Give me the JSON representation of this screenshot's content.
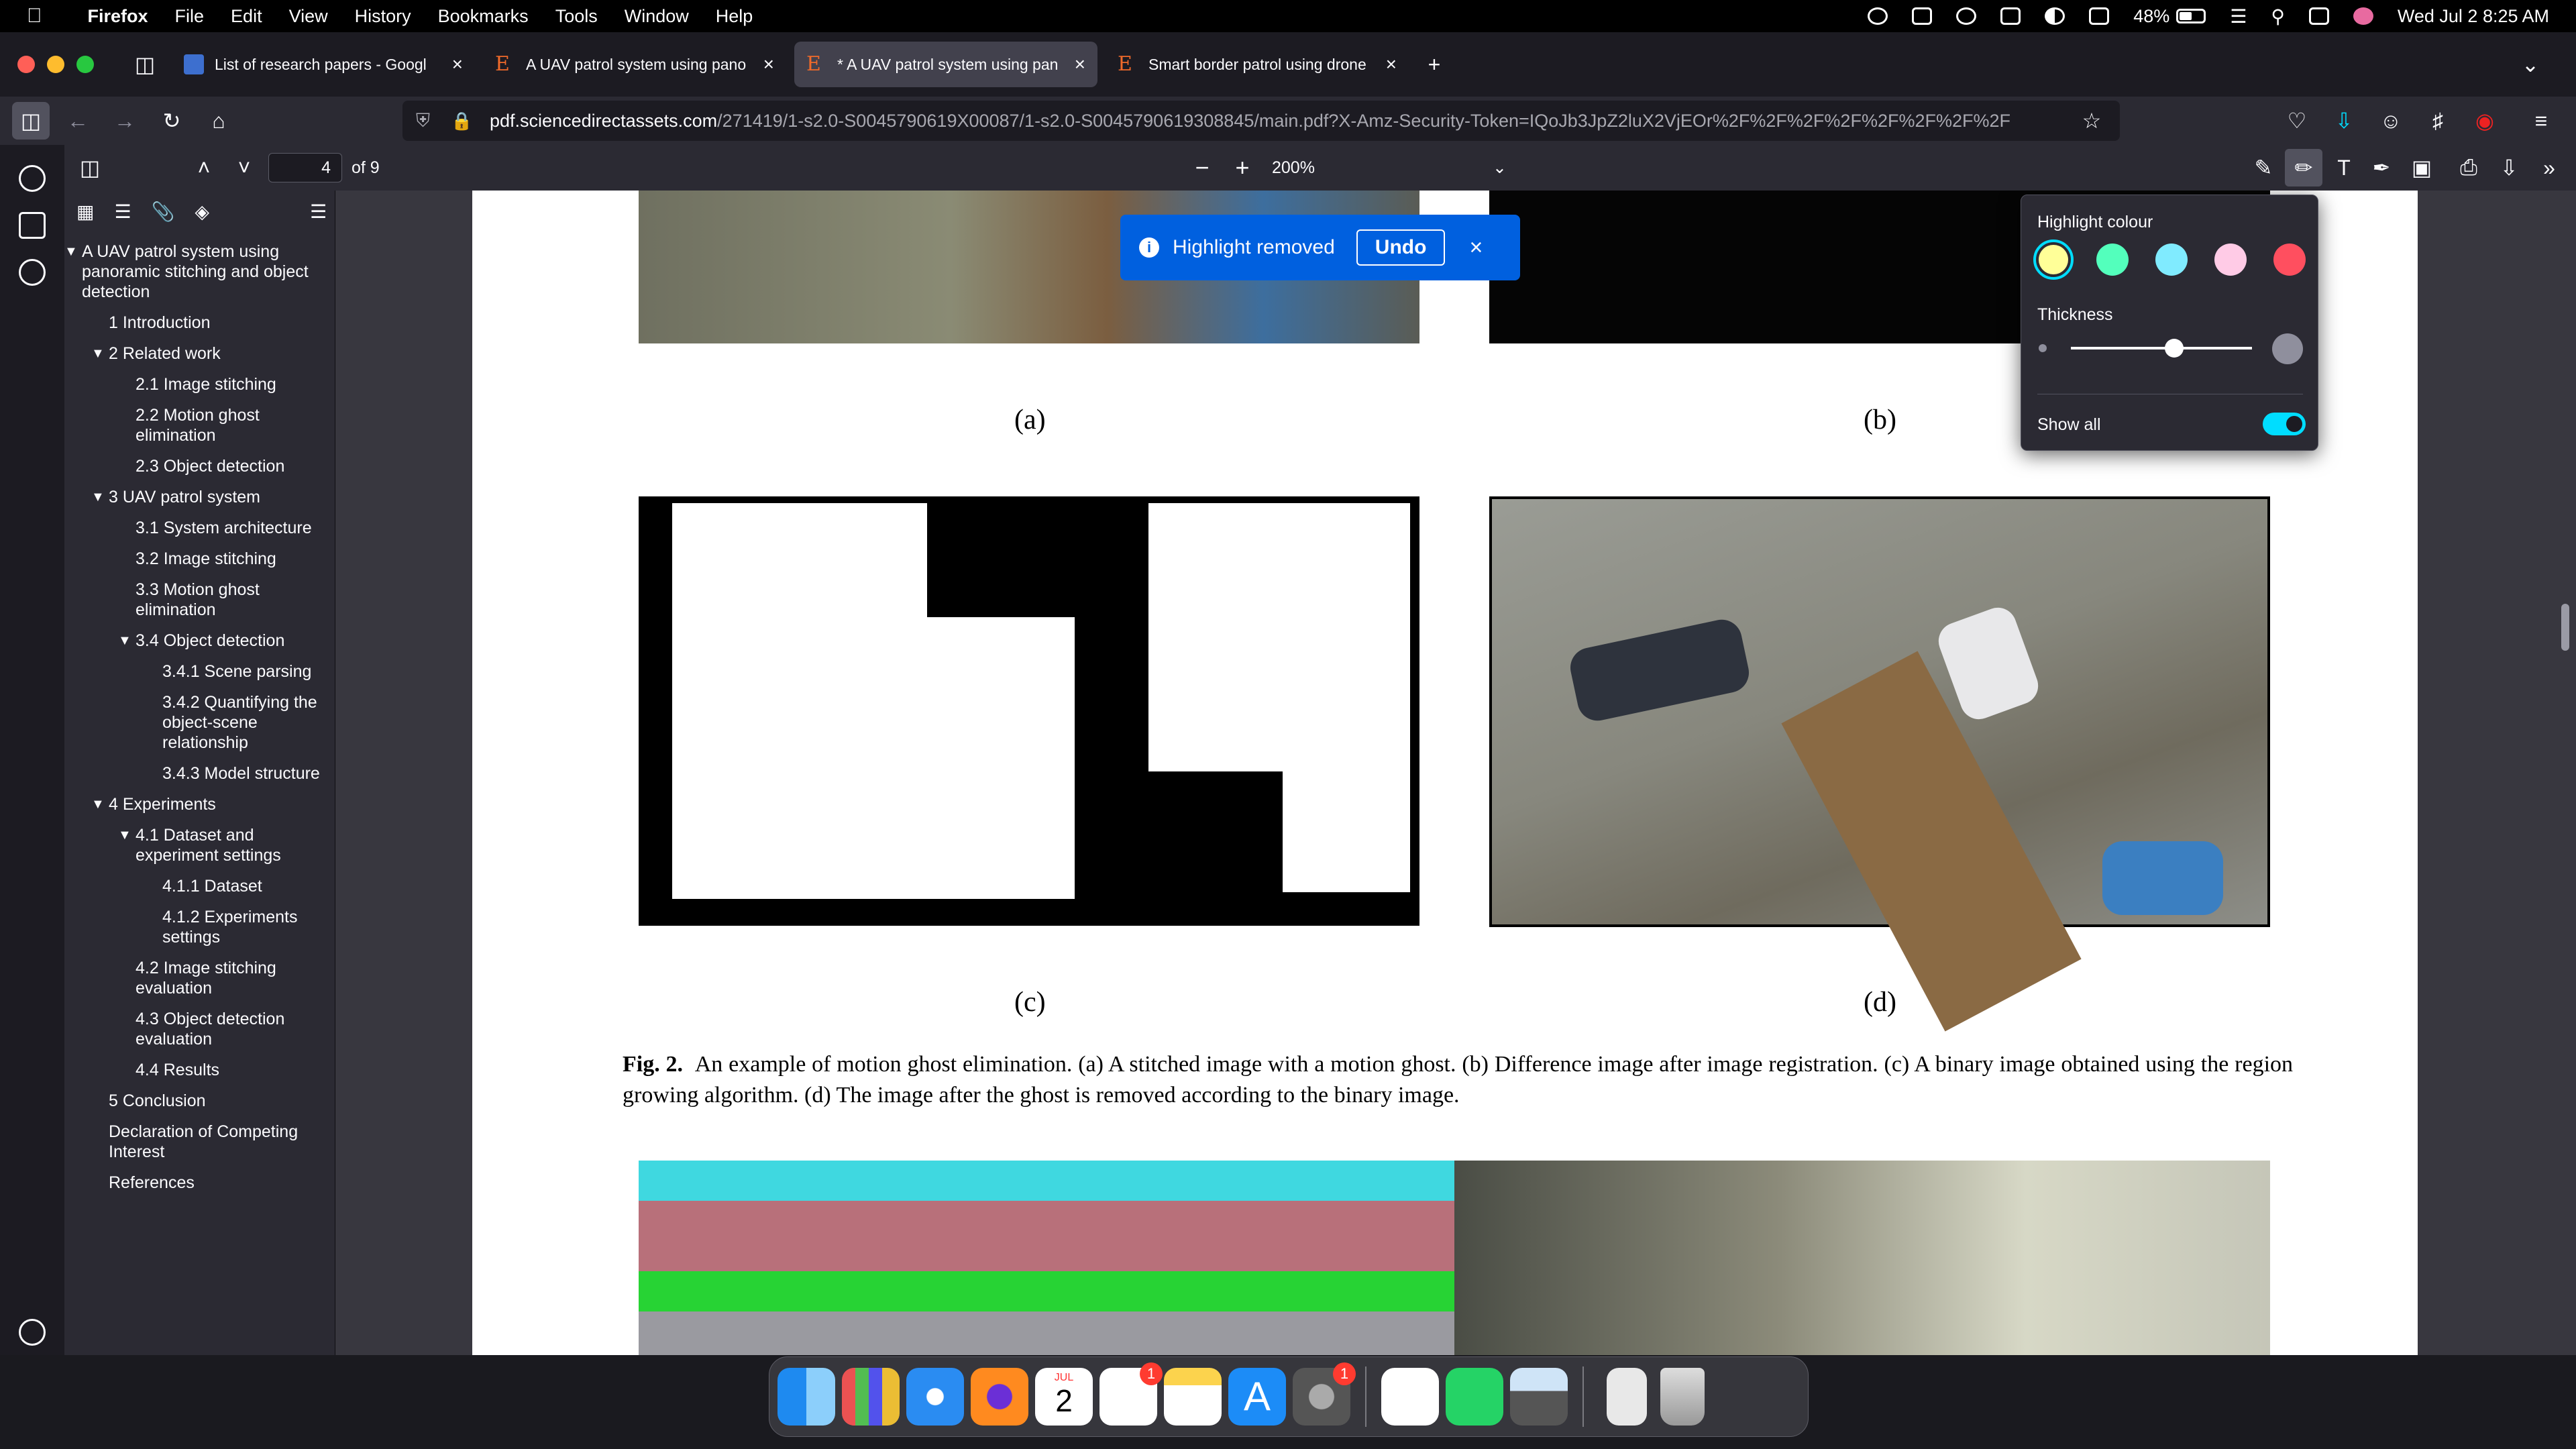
{
  "menubar": {
    "app_name": "Firefox",
    "menus": [
      "File",
      "Edit",
      "View",
      "History",
      "Bookmarks",
      "Tools",
      "Window",
      "Help"
    ],
    "battery": "48%",
    "datetime": "Wed Jul 2  8:25 AM"
  },
  "tabs": [
    {
      "label": "List of research papers - Googl",
      "favicon": "google-doc-icon",
      "active": false
    },
    {
      "label": "A UAV patrol system using pano",
      "favicon": "elsevier-icon",
      "active": false
    },
    {
      "label": "* A UAV patrol system using pan",
      "favicon": "elsevier-icon",
      "active": true
    },
    {
      "label": "Smart border patrol using drone",
      "favicon": "elsevier-icon",
      "active": false
    }
  ],
  "address_bar": {
    "domain": "pdf.sciencedirectassets.com",
    "path": "/271419/1-s2.0-S0045790619X00087/1-s2.0-S0045790619308845/main.pdf?X-Amz-Security-Token=IQoJb3JpZ2luX2VjEOr%2F%2F%2F%2F%2F%2F%2F%2F"
  },
  "pdf_toolbar": {
    "page_number": "4",
    "page_count": "of 9",
    "zoom": "200%"
  },
  "outline": [
    {
      "label": "A UAV patrol system using panoramic stitching and object detection",
      "level": 0,
      "expanded": true
    },
    {
      "label": "1 Introduction",
      "level": 1
    },
    {
      "label": "2 Related work",
      "level": 1,
      "expanded": true
    },
    {
      "label": "2.1 Image stitching",
      "level": 2
    },
    {
      "label": "2.2 Motion ghost elimination",
      "level": 2
    },
    {
      "label": "2.3 Object detection",
      "level": 2
    },
    {
      "label": "3 UAV patrol system",
      "level": 1,
      "expanded": true
    },
    {
      "label": "3.1 System architecture",
      "level": 2
    },
    {
      "label": "3.2 Image stitching",
      "level": 2
    },
    {
      "label": "3.3 Motion ghost elimination",
      "level": 2
    },
    {
      "label": "3.4 Object detection",
      "level": 2,
      "expanded": true
    },
    {
      "label": "3.4.1 Scene parsing",
      "level": 3
    },
    {
      "label": "3.4.2 Quantifying the object-scene relationship",
      "level": 3
    },
    {
      "label": "3.4.3 Model structure",
      "level": 3
    },
    {
      "label": "4 Experiments",
      "level": 1,
      "expanded": true
    },
    {
      "label": "4.1 Dataset and experiment settings",
      "level": 2,
      "expanded": true
    },
    {
      "label": "4.1.1 Dataset",
      "level": 3
    },
    {
      "label": "4.1.2 Experiments settings",
      "level": 3
    },
    {
      "label": "4.2 Image stitching evaluation",
      "level": 2
    },
    {
      "label": "4.3 Object detection evaluation",
      "level": 2
    },
    {
      "label": "4.4 Results",
      "level": 2
    },
    {
      "label": "5 Conclusion",
      "level": 1
    },
    {
      "label": "Declaration of Competing Interest",
      "level": 1
    },
    {
      "label": "References",
      "level": 1
    }
  ],
  "document": {
    "labels": [
      "(a)",
      "(b)",
      "(c)",
      "(d)"
    ],
    "figure_caption_label": "Fig. 2.",
    "figure_caption_text": "An example of motion ghost elimination. (a) A stitched image with a motion ghost. (b) Difference image after image registration. (c) A binary image obtained using the region growing algorithm. (d) The image after the ghost is removed according to the binary image."
  },
  "toast": {
    "message": "Highlight removed",
    "undo_label": "Undo"
  },
  "highlight_popup": {
    "colour_label": "Highlight colour",
    "thickness_label": "Thickness",
    "show_all_label": "Show all",
    "colors": [
      "#ffff98",
      "#53ffbc",
      "#80ebff",
      "#ffcbe6",
      "#ff4f5f"
    ],
    "thickness": 0.2,
    "show_all": true
  },
  "dock": {
    "calendar_month": "JUL",
    "calendar_day": "2",
    "reminders_badge": "1",
    "settings_badge": "1"
  }
}
